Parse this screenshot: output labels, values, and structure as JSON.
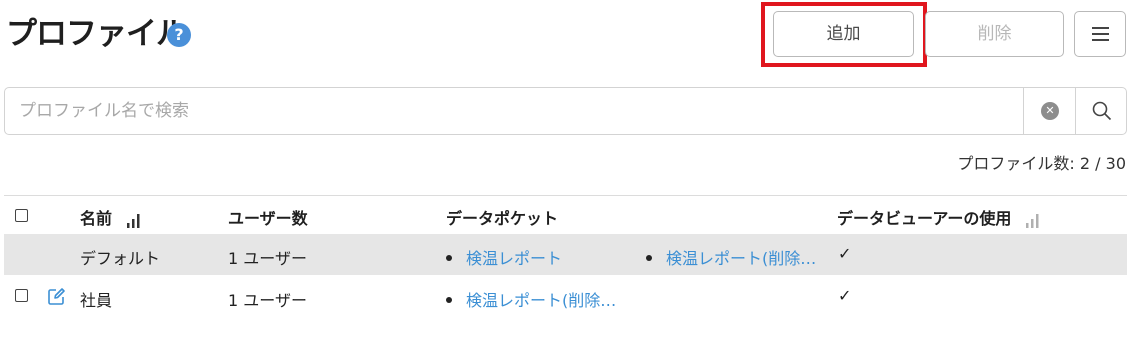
{
  "page": {
    "title": "プロファイル",
    "help_icon": "help-circle-icon"
  },
  "toolbar": {
    "add_label": "追加",
    "delete_label": "削除",
    "menu_icon": "hamburger-menu-icon",
    "highlight_color": "#e0161e"
  },
  "search": {
    "placeholder": "プロファイル名で検索",
    "value": "",
    "clear_icon": "clear-circle-icon",
    "search_icon": "search-icon"
  },
  "count": {
    "label": "プロファイル数:",
    "value": "2 / 30"
  },
  "table": {
    "columns": {
      "name": "名前",
      "users": "ユーザー数",
      "data_pockets": "データポケット",
      "data_viewer": "データビューアーの使用"
    },
    "rows": [
      {
        "name": "デフォルト",
        "users": "1 ユーザー",
        "pockets": [
          "検温レポート",
          "検温レポート(削除…"
        ],
        "viewer": "✓",
        "selected": true,
        "editable": false
      },
      {
        "name": "社員",
        "users": "1 ユーザー",
        "pockets": [
          "検温レポート(削除…"
        ],
        "viewer": "✓",
        "selected": false,
        "editable": true
      }
    ]
  },
  "colors": {
    "link": "#3b8fd4",
    "selected_row": "#e6e6e6",
    "help_icon": "#4a90d9"
  }
}
